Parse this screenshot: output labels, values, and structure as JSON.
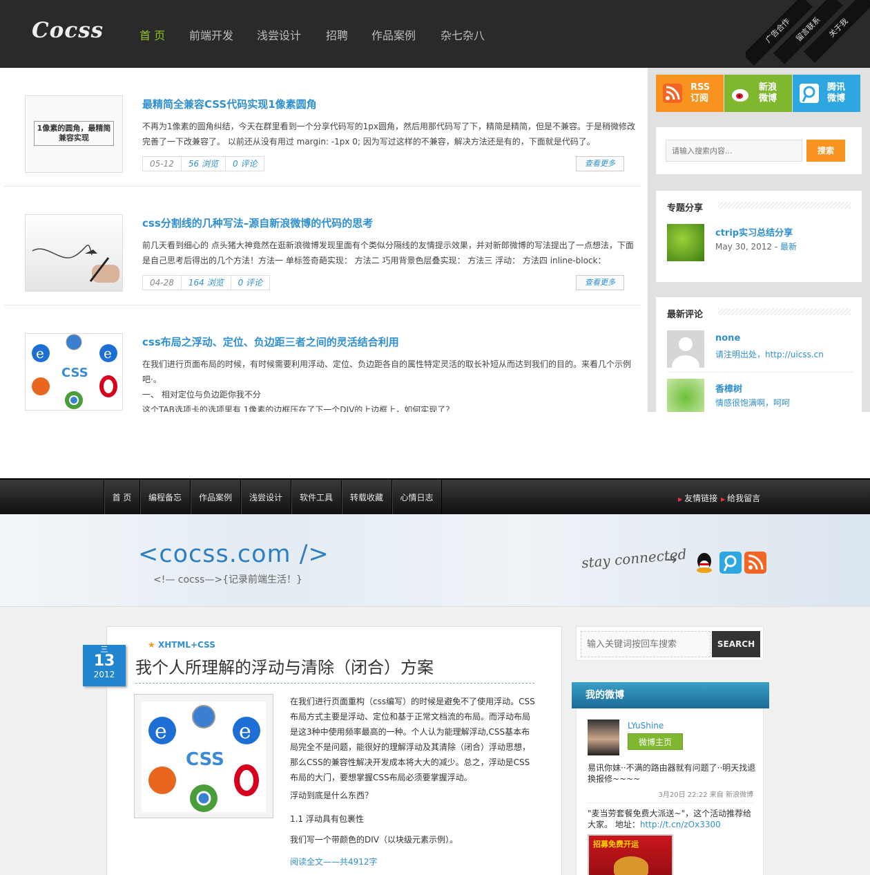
{
  "site1": {
    "logo": "Cocss",
    "nav": [
      "首 页",
      "前端开发",
      "浅尝设计",
      "招聘",
      "作品案例",
      "杂七杂八"
    ],
    "ribbons": [
      "广告合作",
      "留言联系",
      "关于我"
    ],
    "posts": [
      {
        "title": "最精简全兼容CSS代码实现1像素圆角",
        "excerpt": "不再为1像素的圆角纠结，今天在群里看到一个分享代码写的1px圆角，然后用那代码写了下，精简是精简，但是不兼容。于是稍微修改完善了一下改兼容了。 以前还从没有用过 margin: -1px 0; 因为写过这样的不兼容，解决方法还是有的，下面就是代码了。",
        "date": "05-12",
        "views": "56 浏览",
        "comments": "0 评论",
        "more": "查看更多",
        "thumb_text": "1像素的圆角，最精简兼容实现"
      },
      {
        "title": "css分割线的几种写法–源自新浪微博的代码的思考",
        "excerpt": "前几天看到细心的 点头猪大神竟然在逛新浪微博发现里面有个类似分隔线的友情提示效果，并对新郎微博的写法提出了一点想法，下面是自己思考后得出的几个方法！方法一 单标签奇葩实现： 方法二 巧用背景色层叠实现： 方法三 浮动： 方法四 inline-block：",
        "date": "04-28",
        "views": "164 浏览",
        "comments": "0 评论",
        "more": "查看更多"
      },
      {
        "title": "css布局之浮动、定位、负边距三者之间的灵活结合利用",
        "excerpt": "在我们进行页面布局的时候，有时候需要利用浮动、定位、负边距各自的属性特定灵活的取长补短从而达到我们的目的。来看几个示例吧·。",
        "excerpt2": "一、 相对定位与负边距你我不分",
        "excerpt3": "这个TAB选项卡的选项里有 1像素的边框压在了下一个DIV的上边框上，如何实现了？"
      }
    ],
    "social": [
      {
        "label1": "RSS",
        "label2": "订阅",
        "color": "#f7931e"
      },
      {
        "label1": "新浪",
        "label2": "微博",
        "color": "#7fb82f"
      },
      {
        "label1": "腾讯",
        "label2": "微博",
        "color": "#2ea7e0"
      }
    ],
    "search": {
      "placeholder": "请输入搜索内容...",
      "button": "搜索"
    },
    "topics": {
      "heading": "专题分享",
      "item_title": "ctrip实习总结分享",
      "item_date": "May 30, 2012 -",
      "item_tag": "最新"
    },
    "comments": {
      "heading": "最新评论",
      "items": [
        {
          "name": "none",
          "text": "请注明出处，http://uicss.cn"
        },
        {
          "name": "香樟树",
          "text": "情感很饱满啊，呵呵"
        }
      ]
    }
  },
  "site2": {
    "nav": [
      "首 页",
      "编程备忘",
      "作品案例",
      "浅尝设计",
      "软件工具",
      "转载收藏",
      "心情日志"
    ],
    "nav_right": [
      "友情链接",
      "给我留言"
    ],
    "logo": "<cocss.com />",
    "slogan": "<!— cocss—>{记录前端生活！}",
    "stay": "stay connected",
    "arrow": "→",
    "date": {
      "weekday": "三",
      "day": "13",
      "year": "2012"
    },
    "category": "XHTML+CSS",
    "title": "我个人所理解的浮动与清除（闭合）方案",
    "paragraph1": "在我们进行页面重构（css编写）的时候是避免不了使用浮动。CSS布局方式主要是浮动、定位和基于正常文档流的布局。而浮动布局是这3种中使用频率最高的一种。个人认为能理解浮动,CSS基本布局完全不是问题，能很好的理解浮动及其清除（闭合）浮动思想，那么CSS的兼容性解决开发成本将大大的减少。总之，浮动是CSS布局的大门，要想掌握CSS布局必须要掌握浮动。",
    "paragraph2": "浮动到底是什么东西？",
    "paragraph3": "1.1 浮动具有包裹性",
    "paragraph4": "我们写一个带颜色的DIV（以块级元素示例）。",
    "read_more": "阅读全文——共4912字",
    "search": {
      "placeholder": "输入关键词按回车搜索",
      "button": "SEARCH"
    },
    "weibo": {
      "heading": "我的微博",
      "user": "LYuShine",
      "home_button": "微博主页",
      "post1": "易讯你妹··不满的路由器就有问题了··明天找退换报修~~~~",
      "post1_meta": "3月20日 22:22 来自 新浪微博",
      "post2": "\"麦当劳套餐免费大派送~\"，这个活动推荐给大家。 地址：",
      "post2_link": "http://t.cn/zOx3300",
      "promo_text": "招募免费开运"
    }
  }
}
